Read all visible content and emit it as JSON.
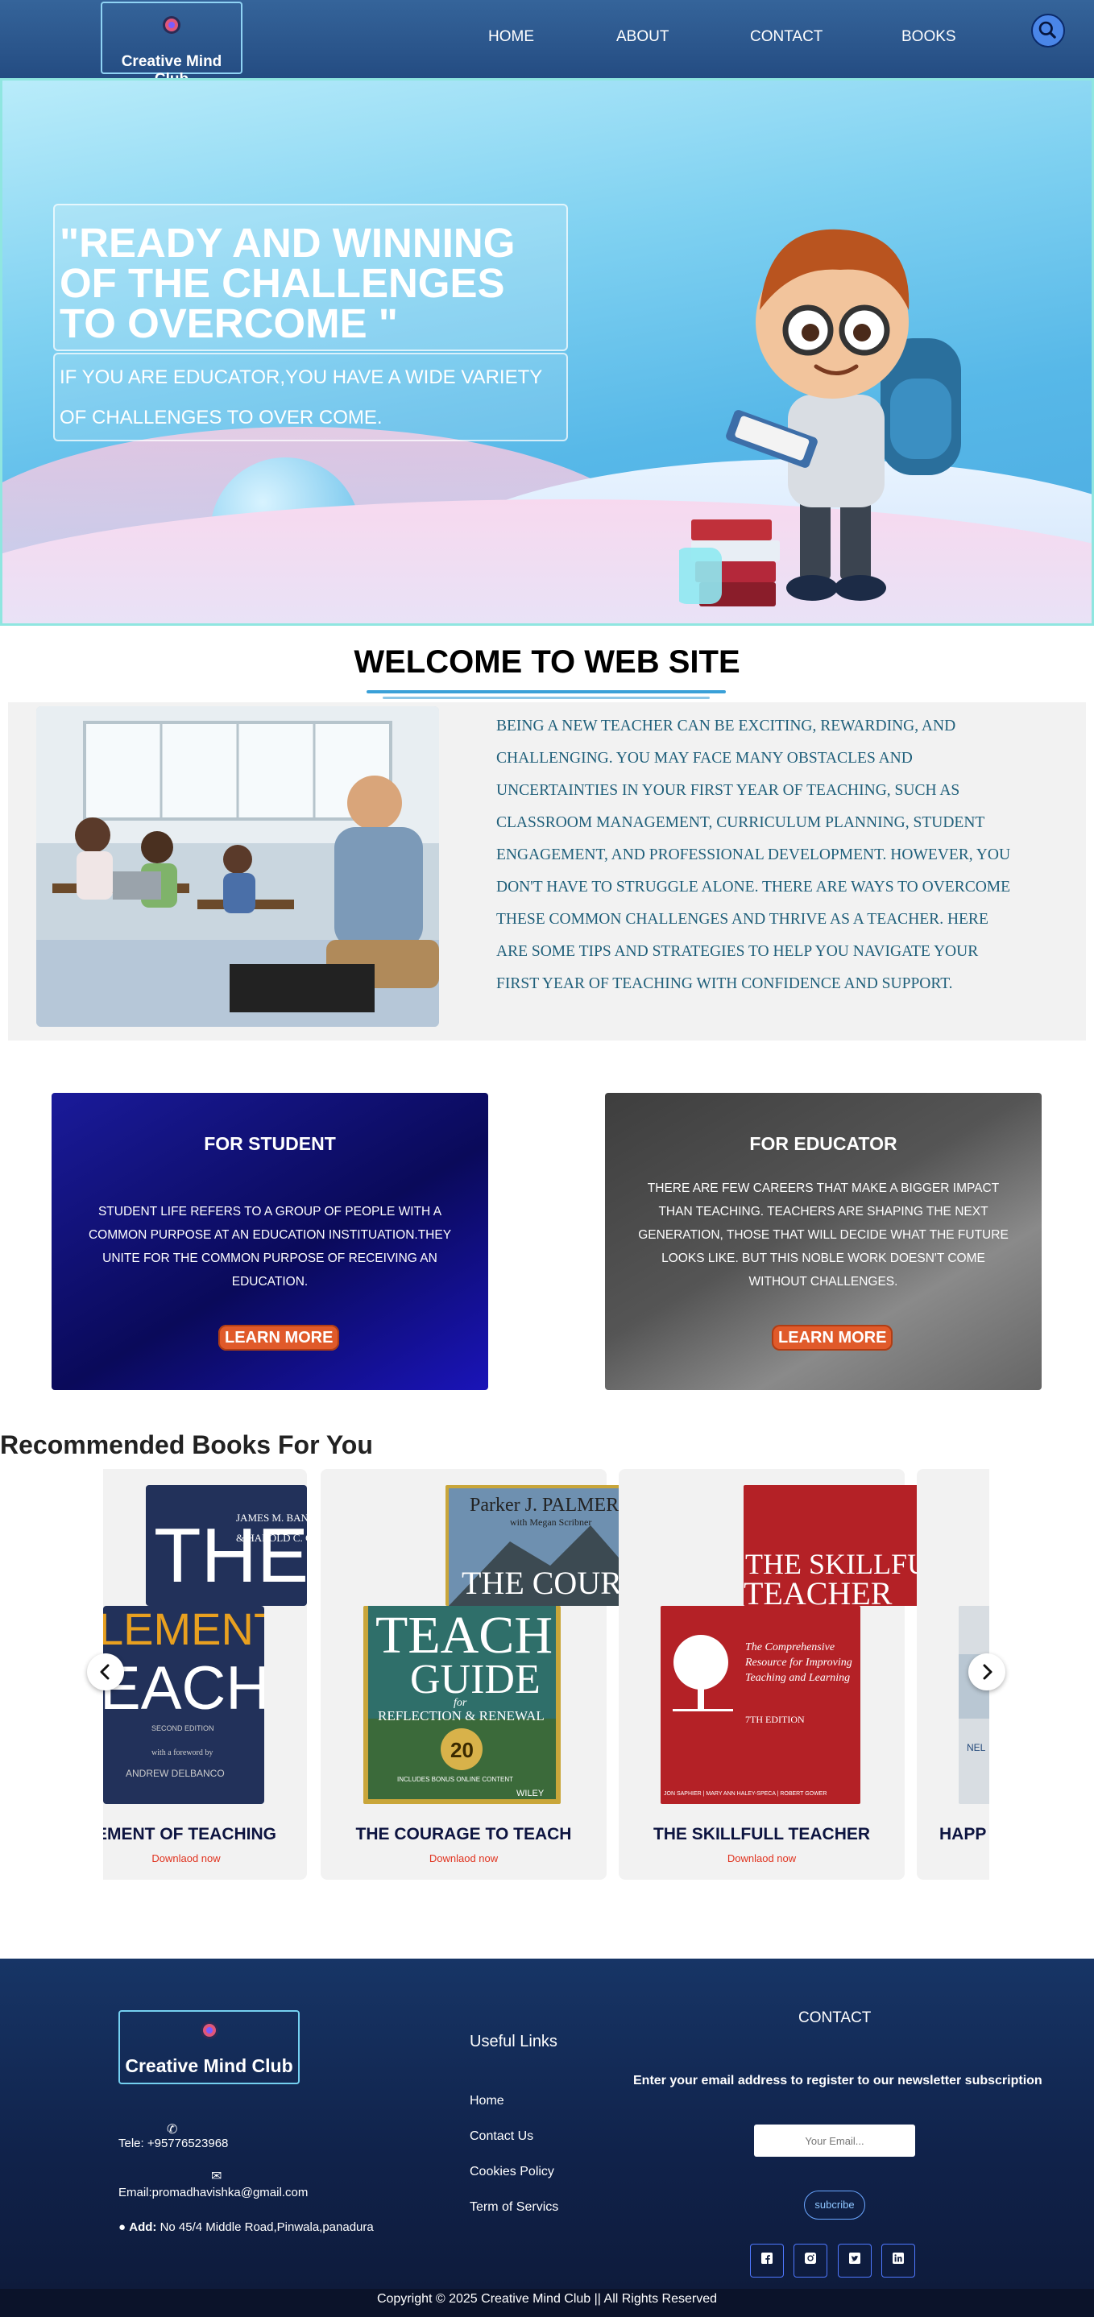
{
  "nav": {
    "logo_text": "Creative Mind Club",
    "links": [
      "HOME",
      "ABOUT",
      "CONTACT",
      "BOOKS"
    ],
    "search_icon": "search-icon"
  },
  "hero": {
    "title": "\"READY AND WINNING OF THE CHALLENGES TO OVERCOME \"",
    "subtitle": "IF YOU ARE EDUCATOR,YOU HAVE A WIDE VARIETY OF CHALLENGES TO OVER COME."
  },
  "welcome": {
    "title": "WELCOME TO WEB SITE",
    "text": "Being a new teacher can be exciting, rewarding, and challenging. You may face many obstacles and uncertainties in your first year of teaching, such as classroom management, curriculum planning, student engagement, and professional development. However, you don't have to struggle alone. There are ways to overcome these common challenges and thrive as a teacher. Here are some tips and strategies to help you navigate your first year of teaching with confidence and support."
  },
  "cards": {
    "student": {
      "title": "FOR STUDENT",
      "text": "STUDENT LIFE REFERS TO A GROUP OF PEOPLE WITH A COMMON PURPOSE AT AN EDUCATION INSTITUATION.THEY UNITE FOR THE COMMON PURPOSE OF RECEIVING AN EDUCATION.",
      "button": "LEARN MORE"
    },
    "educator": {
      "title": "FOR EDUCATOR",
      "text": "THERE ARE FEW CAREERS THAT MAKE A BIGGER IMPACT THAN TEACHING. TEACHERS ARE SHAPING THE NEXT GENERATION, THOSE THAT WILL DECIDE WHAT THE FUTURE LOOKS LIKE. BUT THIS NOBLE WORK DOESN'T COME WITHOUT CHALLENGES.",
      "button": "LEARN MORE"
    }
  },
  "books": {
    "title": "Recommended Books For You",
    "items": [
      {
        "name": "THE ELEMENT OF TEACHING",
        "shown": "EMENT OF TEACHING",
        "download": "Downlaod now"
      },
      {
        "name": "THE COURAGE TO TEACH",
        "download": "Downlaod now"
      },
      {
        "name": "THE SKILLFULL TEACHER",
        "download": "Downlaod now"
      },
      {
        "name": "HAPP",
        "download": ""
      }
    ],
    "cover_texts": {
      "elements_authors": "JAMES M. BANNER, JR. & HAROLD C. CANNON",
      "elements_big1": "THE",
      "elements_big2": "ELEMENTS",
      "elements_lower1": "LEMENTS",
      "elements_lower2": "EACHING",
      "elements_edition": "SECOND EDITION",
      "elements_foreword": "with a foreword by",
      "elements_by": "ANDREW DELBANCO",
      "courage_author": "Parker J. PALMER",
      "courage_with": "with Megan Scribner",
      "courage_title": "THE COURAGE",
      "teach_guide_1": "TEACH",
      "teach_guide_2": "GUIDE",
      "teach_guide_for": "for",
      "teach_guide_3": "REFLECTION & RENEWAL",
      "teach_guide_badge": "20",
      "teach_guide_bonus": "INCLUDES BONUS ONLINE CONTENT",
      "teach_guide_pub": "WILEY",
      "skillful_1": "THE SKILLFUL",
      "skillful_2": "TEACHER",
      "skillful_sub": "The Comprehensive Resource for Improving Teaching and Learning",
      "skillful_ed": "7TH EDITION",
      "skillful_authors": "JON SAPHIER | MARY ANN HALEY-SPECA | ROBERT GOWER",
      "happy_partial": "NEL"
    },
    "prev_icon": "chevron-left-icon",
    "next_icon": "chevron-right-icon"
  },
  "footer": {
    "logo_text": "Creative Mind Club",
    "tel": "Tele: +95776523968",
    "email": "Email:promadhavishka@gmail.com",
    "address_label": "Add:",
    "address": "No 45/4 Middle Road,Pinwala,panadura",
    "useful_links_title": "Useful Links",
    "links": [
      "Home",
      "Contact Us",
      "Cookies Policy",
      "Term of Servics"
    ],
    "contact_title": "CONTACT",
    "newsletter": "Enter your email address to register to our newsletter subscription",
    "email_placeholder": "Your Email...",
    "subscribe": "subcribe",
    "social_icons": [
      "facebook-icon",
      "instagram-icon",
      "twitter-icon",
      "linkedin-icon"
    ],
    "copyright": "Copyright © 2025  Creative Mind Club || All Rights Reserved"
  }
}
